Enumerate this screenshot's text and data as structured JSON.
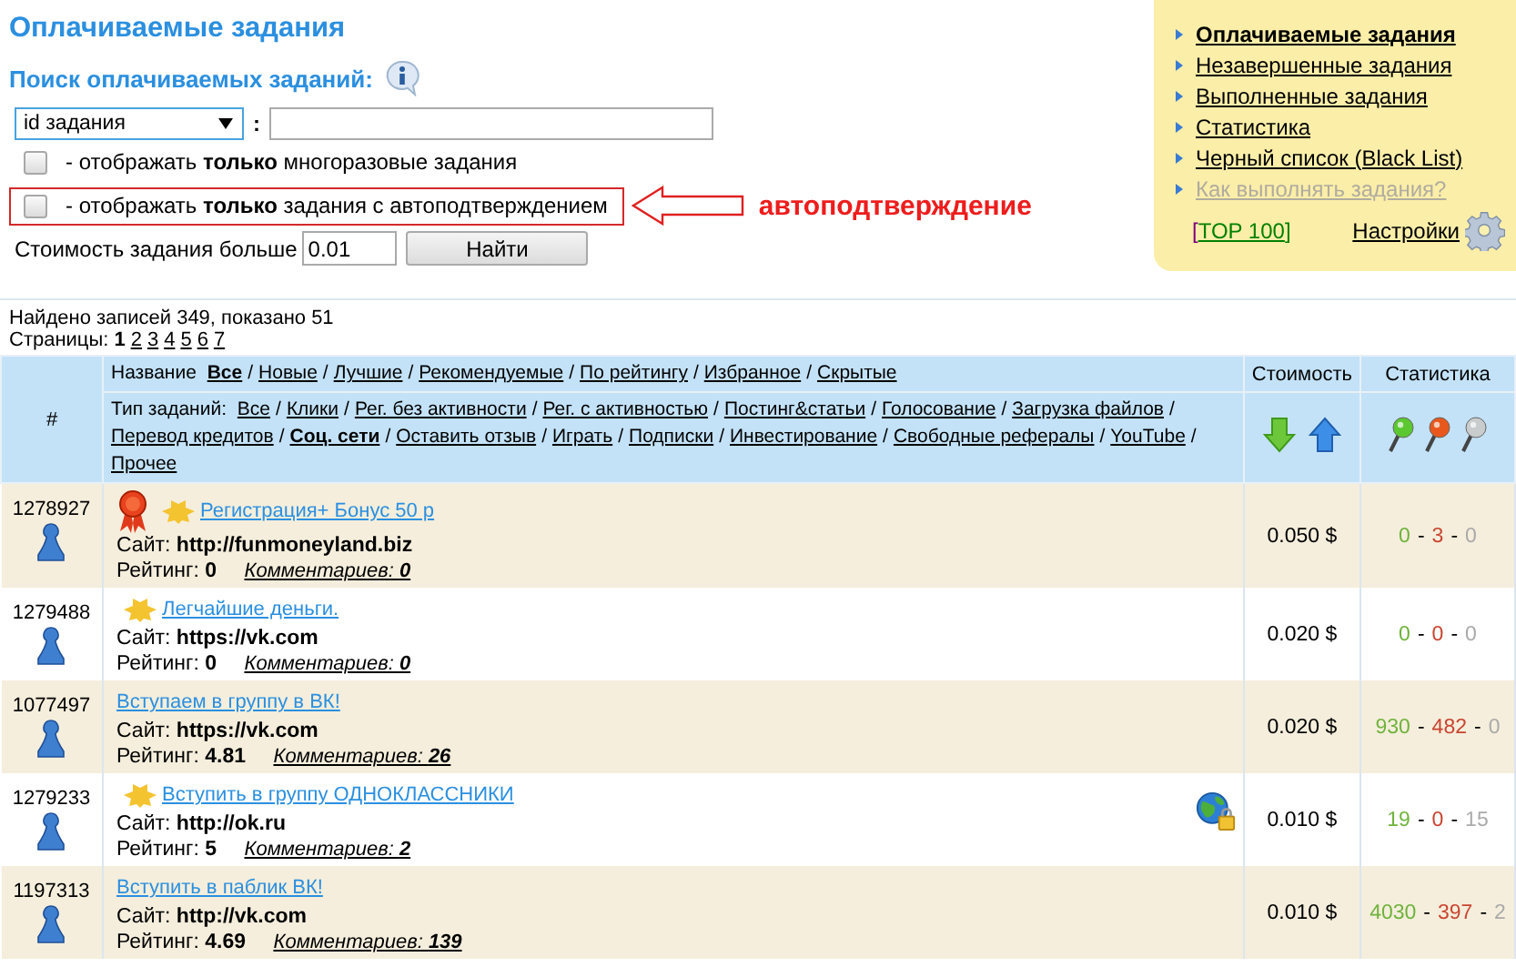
{
  "title": "Оплачиваемые задания",
  "search": {
    "heading": "Поиск оплачиваемых заданий:",
    "field_select": "id задания",
    "colon": ":",
    "options": [
      {
        "kind": "checkbox",
        "checked": false,
        "highlighted": false,
        "prefix": "- отображать ",
        "bold": "только",
        "suffix": " многоразовые задания"
      },
      {
        "kind": "checkbox",
        "checked": false,
        "highlighted": true,
        "prefix": "- отображать ",
        "bold": "только",
        "suffix": " задания с автоподтверждением",
        "annotation": "автоподтверждение"
      }
    ],
    "cost_label": "Стоимость задания больше",
    "cost_value": "0.01",
    "button": "Найти"
  },
  "menu": {
    "items": [
      {
        "label": "Оплачиваемые задания",
        "selected": true,
        "disabled": false
      },
      {
        "label": "Незавершенные задания",
        "selected": false,
        "disabled": false
      },
      {
        "label": "Выполненные задания",
        "selected": false,
        "disabled": false
      },
      {
        "label": "Статистика",
        "selected": false,
        "disabled": false
      },
      {
        "label": "Черный список (Black List)",
        "selected": false,
        "disabled": false
      },
      {
        "label": "Как выполнять задания?",
        "selected": false,
        "disabled": true
      }
    ],
    "bracket_open": "[",
    "top_link": "TOP 100",
    "bracket_close": "]",
    "settings": "Настройки"
  },
  "summary": "Найдено записей 349, показано 51",
  "pages": {
    "label": "Страницы:",
    "items": [
      {
        "label": "1",
        "selected": true
      },
      {
        "label": "2",
        "selected": false
      },
      {
        "label": "3",
        "selected": false
      },
      {
        "label": "4",
        "selected": false
      },
      {
        "label": "5",
        "selected": false
      },
      {
        "label": "6",
        "selected": false
      },
      {
        "label": "7",
        "selected": false
      }
    ]
  },
  "table": {
    "columns": [
      "#",
      "Стоимость",
      "Статистика"
    ],
    "separator": "/",
    "stats_separator": "-",
    "name_filter": {
      "label": "Название",
      "items": [
        {
          "label": "Все",
          "selected": true
        },
        {
          "label": "Новые",
          "selected": false
        },
        {
          "label": "Лучшие",
          "selected": false
        },
        {
          "label": "Рекомендуемые",
          "selected": false
        },
        {
          "label": "По рейтингу",
          "selected": false
        },
        {
          "label": "Избранное",
          "selected": false
        },
        {
          "label": "Скрытые",
          "selected": false
        }
      ]
    },
    "type_filter": {
      "label": "Тип заданий:",
      "items": [
        {
          "label": "Все",
          "selected": false
        },
        {
          "label": "Клики",
          "selected": false
        },
        {
          "label": "Рег. без активности",
          "selected": false
        },
        {
          "label": "Рег. с активностью",
          "selected": false
        },
        {
          "label": "Постинг&статьи",
          "selected": false
        },
        {
          "label": "Голосование",
          "selected": false
        },
        {
          "label": "Загрузка файлов",
          "selected": false
        },
        {
          "label": "Перевод кредитов",
          "selected": false
        },
        {
          "label": "Соц. сети",
          "selected": true
        },
        {
          "label": "Оставить отзыв",
          "selected": false
        },
        {
          "label": "Играть",
          "selected": false
        },
        {
          "label": "Подписки",
          "selected": false
        },
        {
          "label": "Инвестирование",
          "selected": false
        },
        {
          "label": "Свободные рефералы",
          "selected": false
        },
        {
          "label": "YouTube",
          "selected": false
        },
        {
          "label": "Прочее",
          "selected": false
        }
      ]
    },
    "rows": [
      {
        "id": "1278927",
        "award": true,
        "new": true,
        "secure": false,
        "title": "Регистрация+ Бонус 50 р",
        "site_label": "Сайт:",
        "rating_label": "Рейтинг:",
        "site": "http://funmoneyland.biz",
        "rating": "0",
        "comments": "Комментариев: **0**",
        "cost": "0.050 $",
        "stats": [
          "0",
          "3",
          "0"
        ]
      },
      {
        "id": "1279488",
        "award": false,
        "new": true,
        "secure": false,
        "title": "Легчайшие деньги.",
        "site_label": "Сайт:",
        "rating_label": "Рейтинг:",
        "site": "https://vk.com",
        "rating": "0",
        "comments": "Комментариев: **0**",
        "cost": "0.020 $",
        "stats": [
          "0",
          "0",
          "0"
        ]
      },
      {
        "id": "1077497",
        "award": false,
        "new": false,
        "secure": false,
        "title": "Вступаем в группу в ВК!",
        "site_label": "Сайт:",
        "rating_label": "Рейтинг:",
        "site": "https://vk.com",
        "rating": "4.81",
        "comments": "Комментариев: **26**",
        "cost": "0.020 $",
        "stats": [
          "930",
          "482",
          "0"
        ]
      },
      {
        "id": "1279233",
        "award": false,
        "new": true,
        "secure": true,
        "title": "Вступить в группу ОДНОКЛАССНИКИ",
        "site_label": "Сайт:",
        "rating_label": "Рейтинг:",
        "site": "http://ok.ru",
        "rating": "5",
        "comments": "Комментариев: **2**",
        "cost": "0.010 $",
        "stats": [
          "19",
          "0",
          "15"
        ]
      },
      {
        "id": "1197313",
        "award": false,
        "new": false,
        "secure": false,
        "title": "Вступить в паблик ВК!",
        "site_label": "Сайт:",
        "rating_label": "Рейтинг:",
        "site": "http://vk.com",
        "rating": "4.69",
        "comments": "Комментариев: **139**",
        "cost": "0.010 $",
        "stats": [
          "4030",
          "397",
          "2"
        ]
      }
    ]
  }
}
